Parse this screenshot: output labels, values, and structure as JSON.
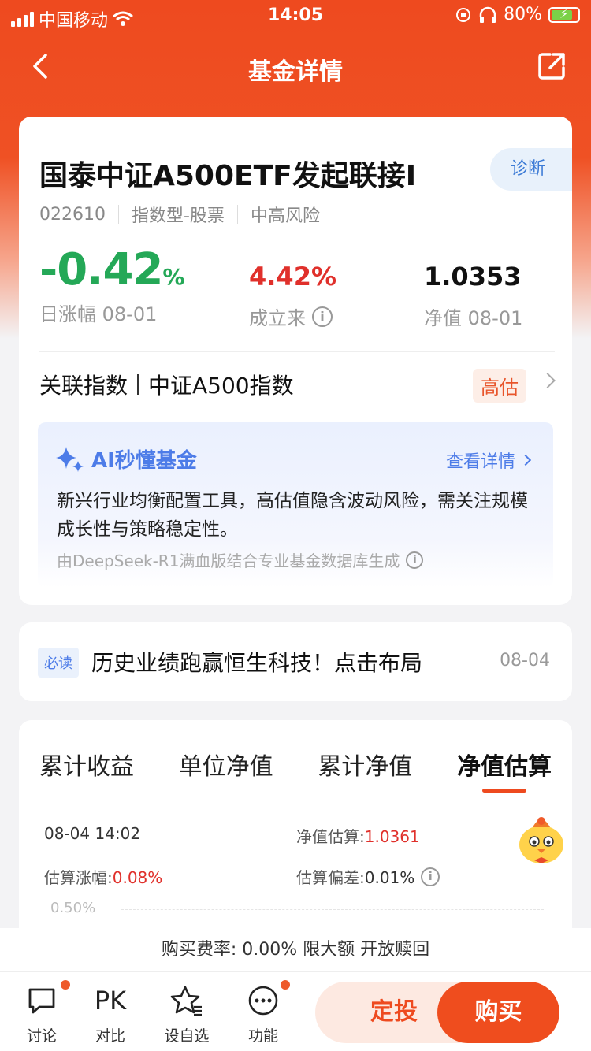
{
  "status_bar": {
    "carrier": "中国移动",
    "time": "14:05",
    "battery": "80%"
  },
  "nav": {
    "title": "基金详情"
  },
  "fund": {
    "name": "国泰中证A500ETF发起联接I",
    "diagnose_label": "诊断",
    "code": "022610",
    "type": "指数型-股票",
    "risk": "中高风险",
    "daily_change_value": "-0.42",
    "daily_change_unit": "%",
    "daily_change_label": "日涨幅 08-01",
    "since_inception_value": "4.42%",
    "since_inception_label": "成立来",
    "nav_value": "1.0353",
    "nav_label": "净值 08-01"
  },
  "index": {
    "label": "关联指数",
    "name": "中证A500指数",
    "valuation_badge": "高估"
  },
  "ai": {
    "title": "AI秒懂基金",
    "more": "查看详情",
    "body": "新兴行业均衡配置工具，高估值隐含波动风险，需关注规模成长性与策略稳定性。",
    "footer": "由DeepSeek-R1满血版结合专业基金数据库生成"
  },
  "news": {
    "badge": "必读",
    "text": "历史业绩跑赢恒生科技！点击布局",
    "date": "08-04"
  },
  "chart_tabs": [
    "累计收益",
    "单位净值",
    "累计净值",
    "净值估算"
  ],
  "estimate": {
    "time": "08-04 14:02",
    "nav_est_label": "净值估算:",
    "nav_est_value": "1.0361",
    "change_label": "估算涨幅:",
    "change_value": "0.08%",
    "deviation_label": "估算偏差:",
    "deviation_value": "0.01%",
    "y_tick": "0.50%"
  },
  "fee": {
    "text": "购买费率: 0.00% 限大额 开放赎回"
  },
  "bottom_bar": {
    "discuss": "讨论",
    "pk_icon": "PK",
    "compare": "对比",
    "watchlist": "设自选",
    "functions": "功能",
    "auto_invest": "定投",
    "buy": "购买"
  },
  "colors": {
    "brand": "#ee4a1f",
    "rise": "#e0302b",
    "fall": "#24a857",
    "ai_blue": "#4d7ce8"
  }
}
